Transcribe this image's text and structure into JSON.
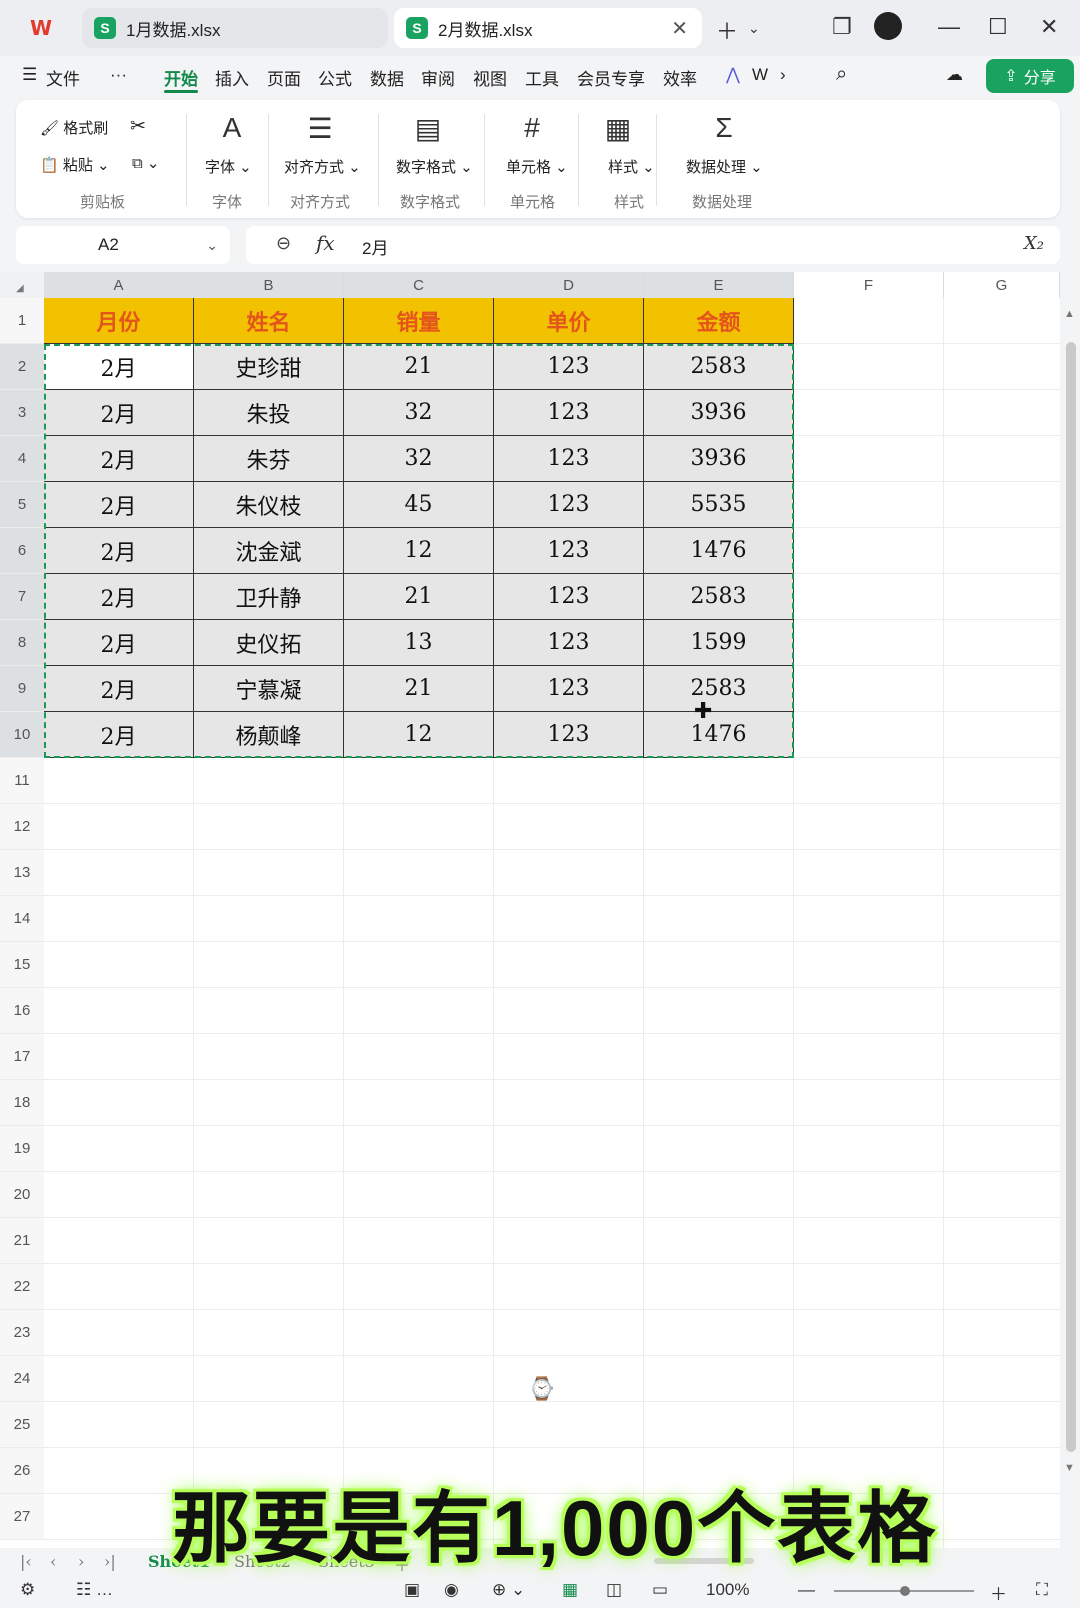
{
  "tabs": [
    {
      "icon": "S",
      "label": "1月数据.xlsx"
    },
    {
      "icon": "S",
      "label": "2月数据.xlsx"
    }
  ],
  "menu": {
    "file": "文件",
    "more": "···",
    "items": [
      "开始",
      "插入",
      "页面",
      "公式",
      "数据",
      "审阅",
      "视图",
      "工具",
      "会员专享",
      "效率"
    ],
    "overflow": "W",
    "share": "分享"
  },
  "ribbon": {
    "format_painter": "格式刷",
    "paste": "粘贴",
    "clipboard_group": "剪贴板",
    "font": "字体",
    "font_group": "字体",
    "align": "对齐方式",
    "align_group": "对齐方式",
    "number_format": "数字格式",
    "number_group": "数字格式",
    "cell": "单元格",
    "cell_group": "单元格",
    "style": "样式",
    "style_group": "样式",
    "data_process": "数据处理",
    "data_group": "数据处理"
  },
  "formula_bar": {
    "name_box": "A2",
    "fx": "fx",
    "value": "2月"
  },
  "grid": {
    "columns": [
      "A",
      "B",
      "C",
      "D",
      "E",
      "F",
      "G"
    ],
    "rows": [
      "1",
      "2",
      "3",
      "4",
      "5",
      "6",
      "7",
      "8",
      "9",
      "10",
      "11",
      "12",
      "13",
      "14",
      "15",
      "16",
      "17",
      "18",
      "19",
      "20",
      "21",
      "22",
      "23",
      "24",
      "25",
      "26",
      "27"
    ],
    "header": [
      "月份",
      "姓名",
      "销量",
      "单价",
      "金额"
    ],
    "data": [
      [
        "2月",
        "史珍甜",
        "21",
        "123",
        "2583"
      ],
      [
        "2月",
        "朱投",
        "32",
        "123",
        "3936"
      ],
      [
        "2月",
        "朱芬",
        "32",
        "123",
        "3936"
      ],
      [
        "2月",
        "朱仪枝",
        "45",
        "123",
        "5535"
      ],
      [
        "2月",
        "沈金斌",
        "12",
        "123",
        "1476"
      ],
      [
        "2月",
        "卫升静",
        "21",
        "123",
        "2583"
      ],
      [
        "2月",
        "史仪拓",
        "13",
        "123",
        "1599"
      ],
      [
        "2月",
        "宁慕凝",
        "21",
        "123",
        "2583"
      ],
      [
        "2月",
        "杨颠峰",
        "12",
        "123",
        "1476"
      ]
    ]
  },
  "sheets": [
    "Sheet1",
    "Sheet2",
    "Sheet3"
  ],
  "status": {
    "zoom": "100%"
  },
  "caption": "那要是有1,000个表格",
  "colors": {
    "accent": "#138a4b",
    "header_fill": "#f2c200",
    "header_text": "#e4551c",
    "caption_glow": "#b7ff5a"
  }
}
